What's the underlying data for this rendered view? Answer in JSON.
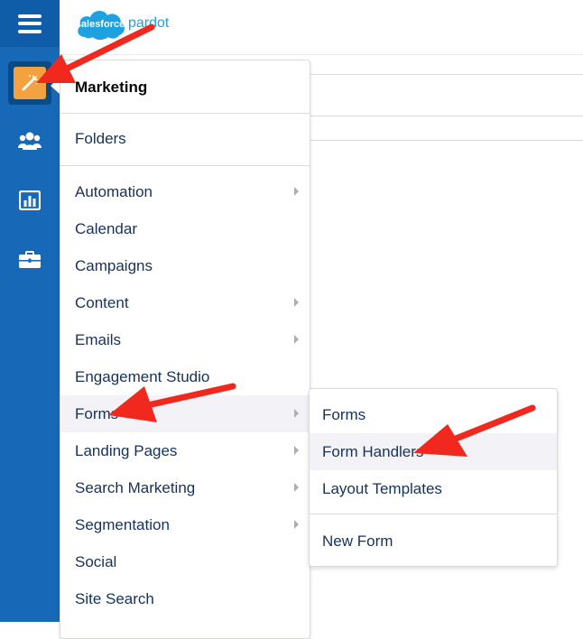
{
  "brand": {
    "logo_text": "salesforce",
    "product_name": "pardot",
    "logo_color": "#1ea1e1"
  },
  "rail": {
    "background_color": "#1769b8",
    "items": [
      {
        "icon": "hamburger-menu-icon"
      },
      {
        "icon": "magic-wand-icon",
        "active": true,
        "accent_color": "#f4a23f"
      },
      {
        "icon": "people-group-icon"
      },
      {
        "icon": "bar-chart-icon"
      },
      {
        "icon": "briefcase-icon"
      }
    ]
  },
  "flyout": {
    "title": "Marketing",
    "items": [
      {
        "label": "Folders",
        "has_submenu": false
      },
      {
        "label": "Automation",
        "has_submenu": true
      },
      {
        "label": "Calendar",
        "has_submenu": false
      },
      {
        "label": "Campaigns",
        "has_submenu": false
      },
      {
        "label": "Content",
        "has_submenu": true
      },
      {
        "label": "Emails",
        "has_submenu": true
      },
      {
        "label": "Engagement Studio",
        "has_submenu": false
      },
      {
        "label": "Forms",
        "has_submenu": true,
        "active": true
      },
      {
        "label": "Landing Pages",
        "has_submenu": true
      },
      {
        "label": "Search Marketing",
        "has_submenu": true
      },
      {
        "label": "Segmentation",
        "has_submenu": true
      },
      {
        "label": "Social",
        "has_submenu": false
      },
      {
        "label": "Site Search",
        "has_submenu": false
      }
    ]
  },
  "submenu": {
    "items": [
      {
        "label": "Forms"
      },
      {
        "label": "Form Handlers",
        "active": true
      },
      {
        "label": "Layout Templates"
      },
      {
        "label": "New Form"
      }
    ]
  },
  "annotation": {
    "arrow_color": "#f0281e",
    "arrow_count": 3
  }
}
